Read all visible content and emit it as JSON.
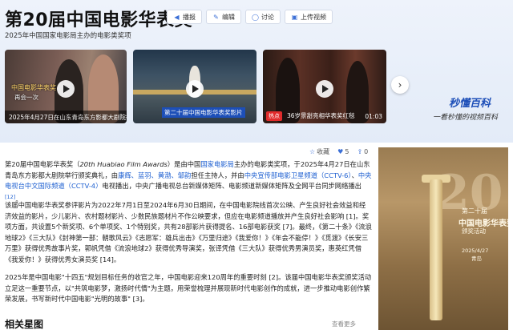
{
  "header": {
    "title": "第20届中国电影华表奖",
    "subtitle": "2025年中国国家电影局主办的电影类奖项",
    "actions": [
      {
        "label": "播报",
        "icon": "speaker-icon"
      },
      {
        "label": "编辑",
        "icon": "edit-icon"
      },
      {
        "label": "讨论",
        "icon": "comment-icon"
      },
      {
        "label": "上传视频",
        "icon": "upload-video-icon"
      }
    ]
  },
  "videos": [
    {
      "overlay_title": "中国电影华表奖",
      "overlay_sub": "再会一次",
      "caption": "2025年4月27日在山东青岛东方影都大剧院举行"
    },
    {
      "banner": "第二十届中国电影华表奖影片",
      "caption": ""
    },
    {
      "badge": "热点",
      "caption": "36岁景甜亮相华表奖红毯",
      "duration": "01:03"
    }
  ],
  "brand": {
    "name": "秒懂百科",
    "slogan": "一看秒懂的视频百科"
  },
  "tools": {
    "favorite": "收藏",
    "like_count": "5",
    "share_count": "0"
  },
  "article": {
    "p1": {
      "a": "第20届中国电影华表奖（",
      "en": "20th Huabiao Film Awards",
      "b": "）是由中国",
      "l1": "国家电影局",
      "c": "主办的电影类奖项，于2025年4月27日在山东青岛东方影都大剧院举行颁奖典礼，由",
      "l2": "康辉、蓝羽、黄渤、邹韵",
      "d": "担任主持人，并由",
      "l3": "中央宣传部电影卫星频道（CCTV-6）",
      "e": "、",
      "l4": "中央电视台中文国际频道（CCTV-4）",
      "f": "电视播出，中央广播电视总台新媒体矩阵、电影频道新媒体矩阵及全网平台同步网络播出",
      "ref": "[12]",
      "g": "。"
    },
    "p2": "该届中国电影华表奖参评影片为2022年7月1日至2024年6月30日期间，在中国电影院线首次公映、产生良好社会效益和经济效益的影片，少儿影片、农村题材影片、少数民族题材片不作公映要求，但应在电影频道播放并产生良好社会影响 [1]。奖项方面，共设置5个新奖项、6个单项奖、1个特别奖，共有28部影片获得提名、16部电影获奖 [7]。最终，《第二十条》《流浪地球2》《三大队》《封神第一部：朝歌风云》《志愿军：雄兵出击》《万里归途》《我爱你！》《年会不能停！》《觅渡》《长安三万里》获得优秀故事片奖，郭帆凭借《流浪地球2》获得优秀导演奖，张译凭借《三大队》获得优秀男演员奖，惠英红凭借《我爱你！》获得优秀女演员奖 [14]。",
    "p3": "2025年是中国电影\"十四五\"规划目标任务的收官之年，中国电影迎来120周年的重要时刻 [2]。该届中国电影华表奖颁奖活动立足这一重要节点，以\"共筑电影梦，激扬时代情\"为主题，用荣誉梳理并展现新时代电影创作的成就，进一步推动电影创作繁荣发展，书写新时代中国电影\"光明的故事\" [3]。"
  },
  "section_title": "相关星图",
  "see_more": "查看更多",
  "poster": {
    "watermark": "20",
    "line1": "第二十届",
    "line2": "中国电影华表奖",
    "line3": "颁奖活动",
    "date": "2025/4/27",
    "city": "青岛"
  }
}
